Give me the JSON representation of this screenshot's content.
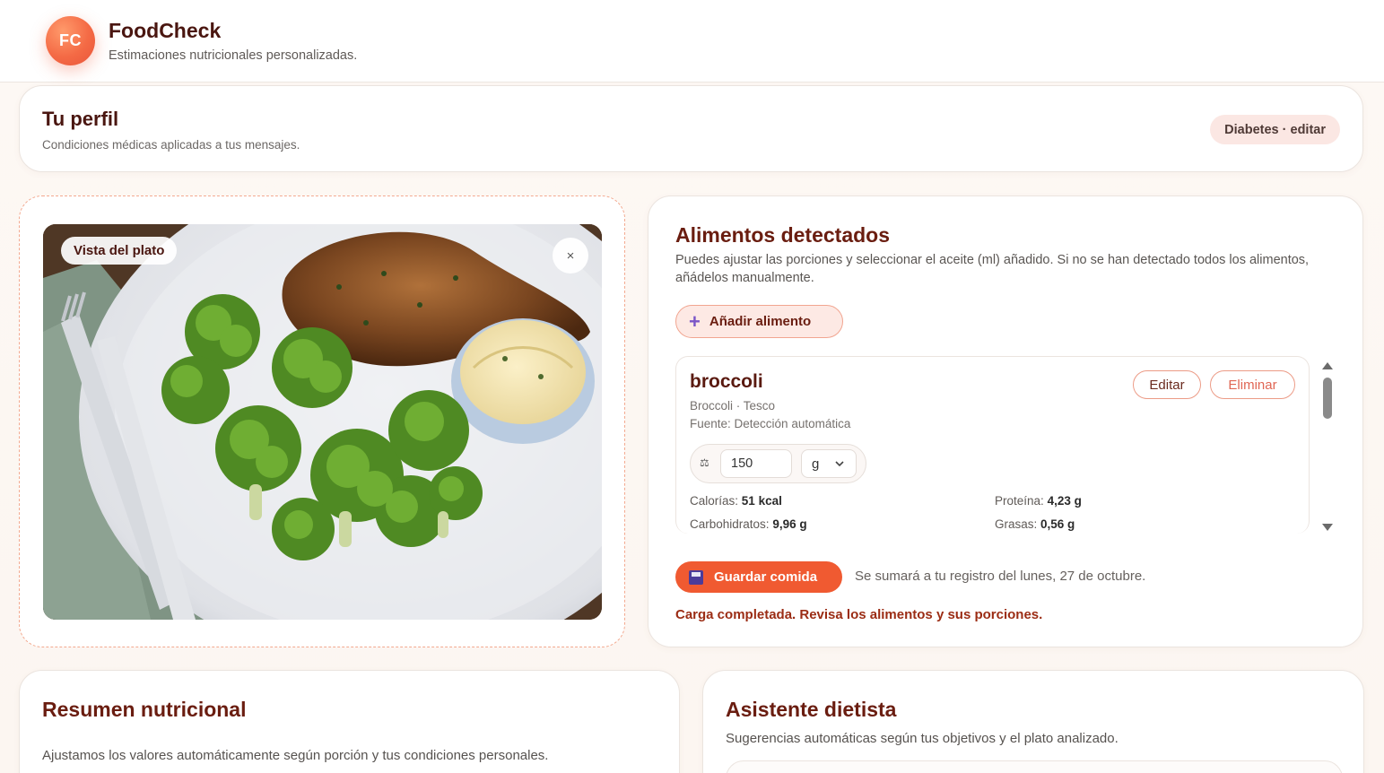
{
  "header": {
    "logo_text": "FC",
    "title": "FoodCheck",
    "subtitle": "Estimaciones nutricionales personalizadas."
  },
  "profile": {
    "title": "Tu perfil",
    "subtitle": "Condiciones médicas aplicadas a tus mensajes.",
    "pill": "Diabetes · editar"
  },
  "image_panel": {
    "badge": "Vista del plato",
    "close": "×"
  },
  "foods": {
    "title": "Alimentos detectados",
    "description": "Puedes ajustar las porciones y seleccionar el aceite (ml) añadido. Si no se han detectado todos los alimentos, añádelos manualmente.",
    "add_button": "Añadir alimento",
    "items": [
      {
        "name": "broccoli",
        "brand": "Broccoli · Tesco",
        "source": "Fuente: Detección automática",
        "edit_label": "Editar",
        "delete_label": "Eliminar",
        "quantity": "150",
        "unit": "g",
        "calories_label": "Calorías:",
        "calories_value": "51 kcal",
        "protein_label": "Proteína:",
        "protein_value": "4,23 g",
        "carbs_label": "Carbohidratos:",
        "carbs_value": "9,96 g",
        "fat_label": "Grasas:",
        "fat_value": "0,56 g"
      }
    ],
    "save_button": "Guardar comida",
    "save_note": "Se sumará a tu registro del lunes, 27 de octubre.",
    "status": "Carga completada. Revisa los alimentos y sus porciones."
  },
  "summary": {
    "title": "Resumen nutricional",
    "subtitle": "Ajustamos los valores automáticamente según porción y tus condiciones personales."
  },
  "assistant": {
    "title": "Asistente dietista",
    "subtitle": "Sugerencias automáticas según tus objetivos y el plato analizado."
  },
  "colors": {
    "accent": "#f05a31",
    "title": "#6a1d10",
    "pill_bg": "#fbe7e3"
  }
}
